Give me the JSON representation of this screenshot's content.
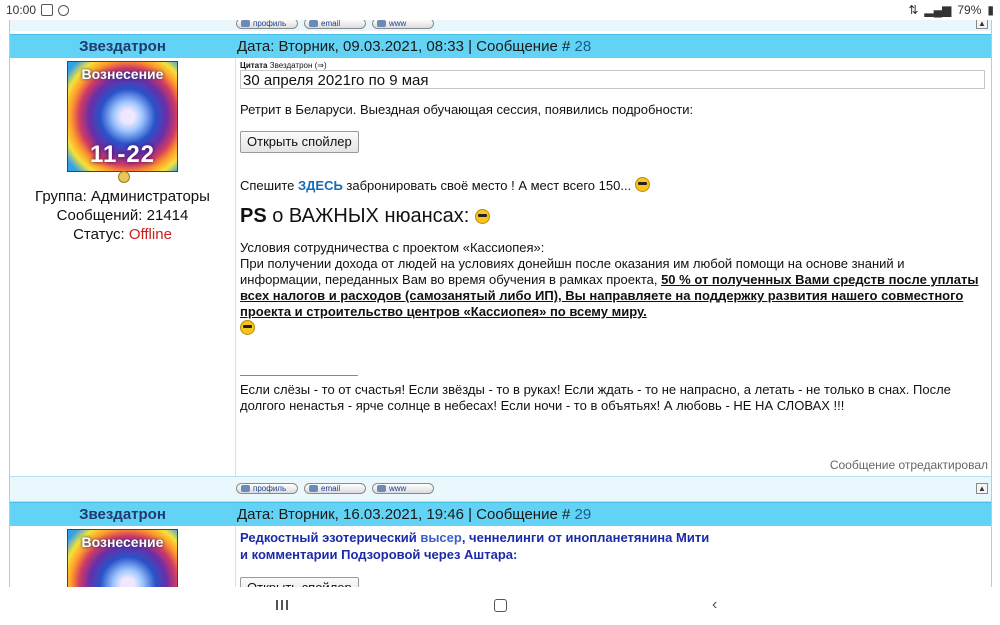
{
  "status_bar": {
    "time": "10:00",
    "battery": "79%"
  },
  "buttons": {
    "profile": "профиль",
    "email": "email",
    "www": "www"
  },
  "post1": {
    "author": "Звездатрон",
    "meta_prefix": "Дата: Вторник, 09.03.2021, 08:33 | Сообщение # ",
    "number": "28",
    "avatar_title": "Вознесение",
    "avatar_number": "11-22",
    "group": "Группа: Администраторы",
    "messages": "Сообщений: 21414",
    "status_label": "Статус: ",
    "status_value": "Offline",
    "quote_label": "Цитата",
    "quote_author": "Звездатрон (⇒)",
    "quote_text": "30 апреля 2021го по 9 мая",
    "retreat_text": "Ретрит в Беларуси. Выездная обучающая сессия, появились подробности:",
    "spoiler_button": "Открыть спойлер",
    "hurry_before": "Спешите ",
    "hurry_link": "ЗДЕСЬ",
    "hurry_after": " забронировать своё место ! А мест всего 150...",
    "ps_bold": "PS",
    "ps_rest": " о ВАЖНЫХ нюансах:",
    "terms_title": "Условия сотрудничества с проектом «Кассиопея»:",
    "terms_text": "При получении дохода от людей на условиях донейшн после оказания им любой помощи на основе знаний и информации, переданных Вам во время обучения в рамках проекта, ",
    "terms_bold": "50 % от полученных Вами средств после уплаты всех налогов и расходов (самозанятый либо ИП), Вы направляете на поддержку развития нашего совместного проекта и строительство центров «Кассиопея» по всему миру.",
    "signature": "Если слёзы - то от счастья! Если звёзды - то в руках! Если ждать - то не напрасно, а летать - не только в снах. После долгого ненастья - ярче солнце в небесах! Если ночи - то в объятьях! А любовь - НЕ НА СЛОВАХ !!!",
    "edited": "Сообщение отредактировал"
  },
  "post2": {
    "author": "Звездатрон",
    "meta_prefix": "Дата: Вторник, 16.03.2021, 19:46 | Сообщение # ",
    "number": "29",
    "avatar_title": "Вознесение",
    "title_part1": "Редкостный эзотерический ",
    "title_link": "высер",
    "title_part2": ", ченнелинги от инопланетянина Мити",
    "title_line2": "и комментарии Подзоровой через Аштара:",
    "spoiler_button": "Открыть спойлер"
  },
  "colors": {
    "header_bg": "#62d3f5",
    "link_blue": "#1a6bb5",
    "offline_red": "#c81e1e",
    "title_blue": "#1b2aa8"
  }
}
